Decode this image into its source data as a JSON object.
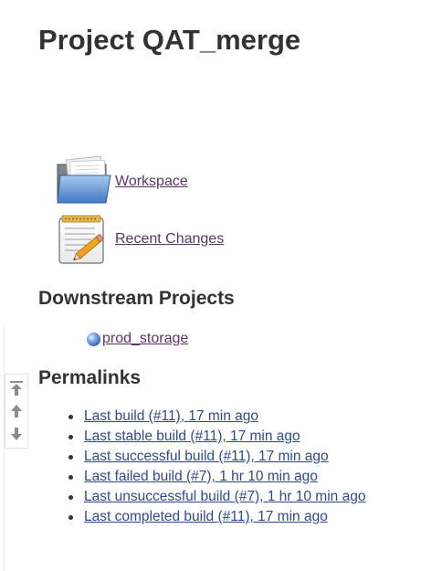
{
  "page": {
    "title": "Project QAT_merge"
  },
  "tasks": [
    {
      "label": "Workspace",
      "icon": "folder-icon"
    },
    {
      "label": "Recent Changes",
      "icon": "notepad-icon"
    }
  ],
  "downstream": {
    "heading": "Downstream Projects",
    "items": [
      {
        "label": "prod_storage",
        "status_color": "#3465a4",
        "icon": "blue-ball-icon"
      }
    ]
  },
  "permalinks": {
    "heading": "Permalinks",
    "items": [
      {
        "label": "Last build (#11), 17 min ago"
      },
      {
        "label": "Last stable build (#11), 17 min ago"
      },
      {
        "label": "Last successful build (#11), 17 min ago"
      },
      {
        "label": "Last failed build (#7), 1 hr 10 min ago"
      },
      {
        "label": "Last unsuccessful build (#7), 1 hr 10 min ago"
      },
      {
        "label": "Last completed build (#11), 17 min ago"
      }
    ]
  },
  "scroll_widget": {
    "buttons": [
      "scroll-to-top-icon",
      "scroll-up-icon",
      "scroll-down-icon"
    ]
  },
  "colors": {
    "visited_link": "#5c3566",
    "link": "#2e4a8c",
    "text": "#333333"
  }
}
